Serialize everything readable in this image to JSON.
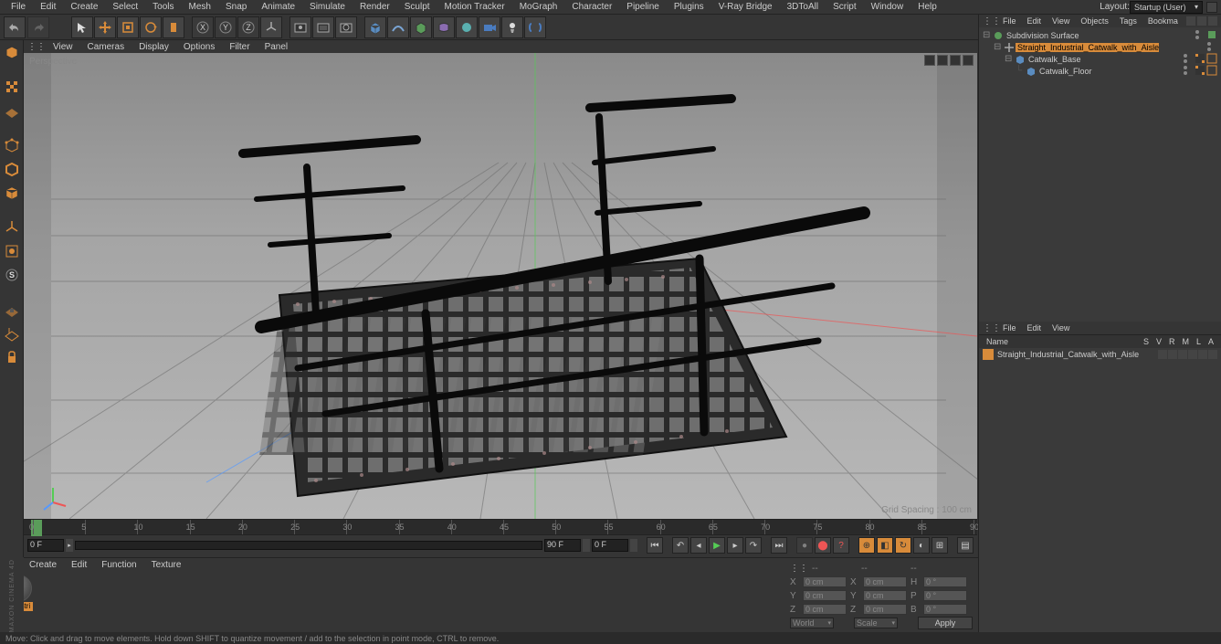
{
  "menu": {
    "items": [
      "File",
      "Edit",
      "Create",
      "Select",
      "Tools",
      "Mesh",
      "Snap",
      "Animate",
      "Simulate",
      "Render",
      "Sculpt",
      "Motion Tracker",
      "MoGraph",
      "Character",
      "Pipeline",
      "Plugins",
      "V-Ray Bridge",
      "3DToAll",
      "Script",
      "Window",
      "Help"
    ],
    "layout_label": "Layout:",
    "layout_value": "Startup (User)"
  },
  "viewport_menu": [
    "View",
    "Cameras",
    "Display",
    "Options",
    "Filter",
    "Panel"
  ],
  "viewport": {
    "label": "Perspective",
    "grid_spacing": "Grid Spacing : 100 cm"
  },
  "timeline": {
    "start": "0 F",
    "end": "90 F",
    "current": "0 F",
    "ticks": [
      "0",
      "5",
      "10",
      "15",
      "20",
      "25",
      "30",
      "35",
      "40",
      "45",
      "50",
      "55",
      "60",
      "65",
      "70",
      "75",
      "80",
      "85",
      "90"
    ]
  },
  "bottom_menu": [
    "Create",
    "Edit",
    "Function",
    "Texture"
  ],
  "material": {
    "name": "Industri"
  },
  "coords": {
    "x": "0 cm",
    "y": "0 cm",
    "z": "0 cm",
    "sx": "0 cm",
    "sy": "0 cm",
    "sz": "0 cm",
    "h": "0 °",
    "p": "0 °",
    "b": "0 °",
    "mode1": "World",
    "mode2": "Scale",
    "apply": "Apply"
  },
  "objects_menu": [
    "File",
    "Edit",
    "View",
    "Objects",
    "Tags",
    "Bookma"
  ],
  "objects": [
    {
      "name": "Subdivision Surface",
      "indent": 0,
      "icon": "subdiv",
      "expanded": true
    },
    {
      "name": "Straight_Industrial_Catwalk_with_Aisle",
      "indent": 1,
      "icon": "null",
      "expanded": true,
      "selected": true
    },
    {
      "name": "Catwalk_Base",
      "indent": 2,
      "icon": "poly",
      "expanded": true
    },
    {
      "name": "Catwalk_Floor",
      "indent": 3,
      "icon": "poly",
      "expanded": false
    }
  ],
  "materials_menu": [
    "File",
    "Edit",
    "View"
  ],
  "materials_header": {
    "name": "Name",
    "cols": [
      "S",
      "V",
      "R",
      "M",
      "L",
      "A"
    ]
  },
  "materials_list": [
    {
      "name": "Straight_Industrial_Catwalk_with_Aisle"
    }
  ],
  "status": "Move: Click and drag to move elements. Hold down SHIFT to quantize movement / add to the selection in point mode, CTRL to remove.",
  "logo": "MAXON CINEMA 4D"
}
